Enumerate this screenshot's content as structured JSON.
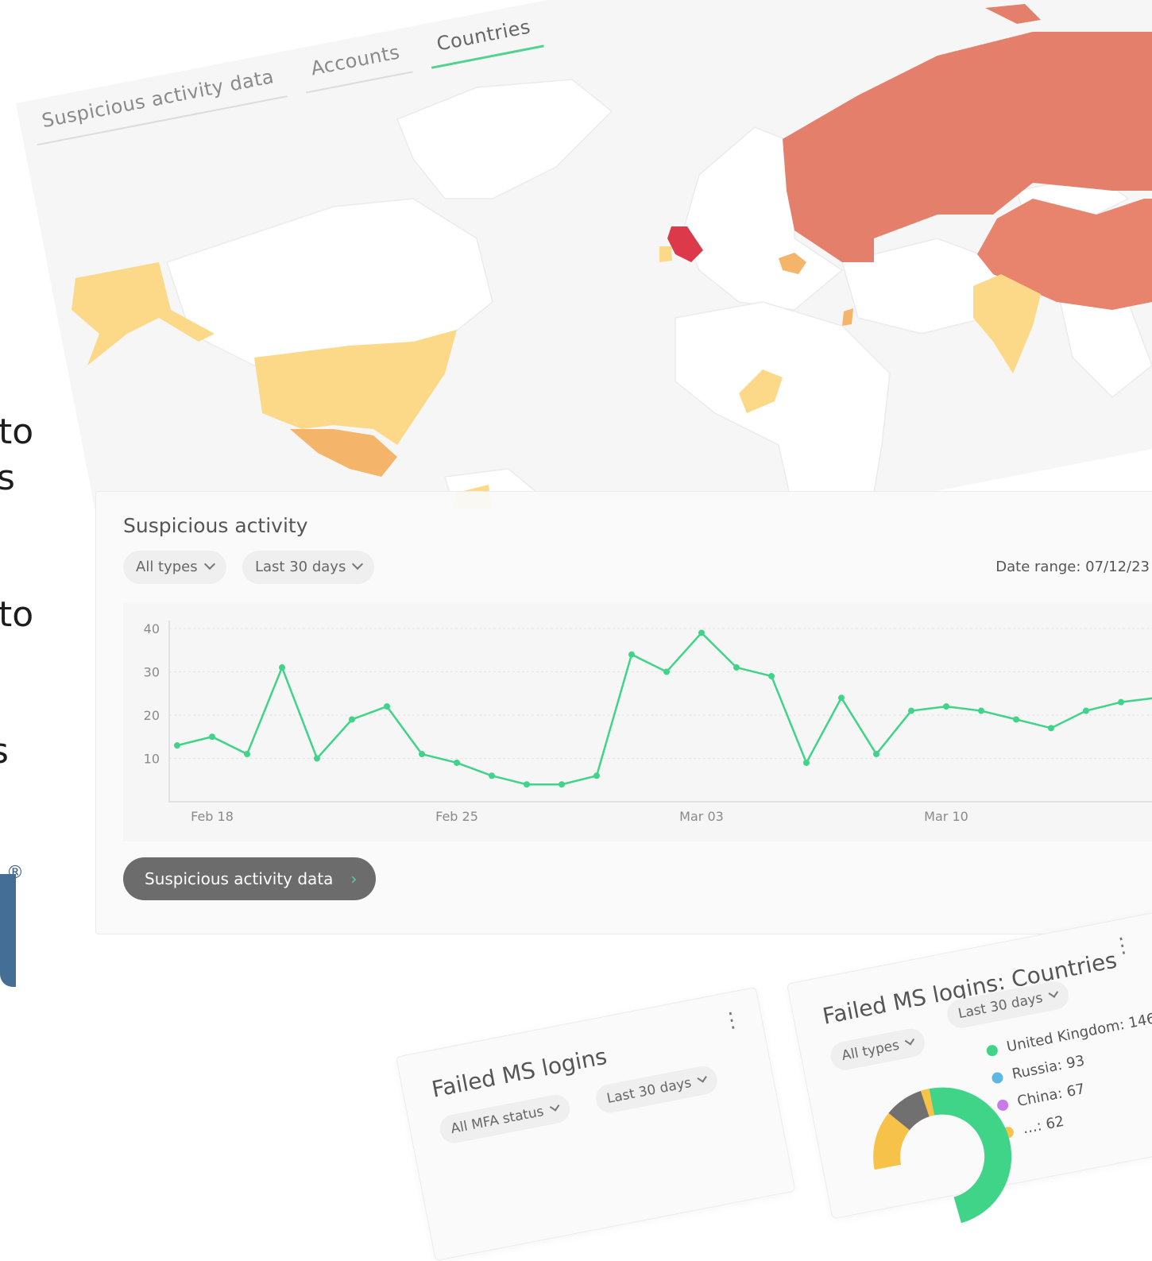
{
  "edge_texts": [
    "to",
    "s",
    "to",
    "s"
  ],
  "brand": {
    "registered": "®"
  },
  "tabs": [
    {
      "label": "Suspicious activity data",
      "active": false
    },
    {
      "label": "Accounts",
      "active": false
    },
    {
      "label": "Countries",
      "active": true
    }
  ],
  "map_colors": {
    "none": "#ffffff",
    "low": "#fbd988",
    "medium": "#f4b46a",
    "high": "#e47f6c",
    "highest": "#dc3a4b"
  },
  "card": {
    "title": "Suspicious activity",
    "filter_type": "All types",
    "filter_range": "Last 30 days",
    "date_range": "Date range: 07/12/23",
    "cta": "Suspicious activity data",
    "cta_arrow": "›"
  },
  "chart_data": {
    "type": "line",
    "x": [
      "Feb 17",
      "Feb 18",
      "Feb 19",
      "Feb 20",
      "Feb 21",
      "Feb 22",
      "Feb 23",
      "Feb 24",
      "Feb 25",
      "Feb 26",
      "Feb 27",
      "Feb 28",
      "Feb 29",
      "Mar 01",
      "Mar 02",
      "Mar 03",
      "Mar 04",
      "Mar 05",
      "Mar 06",
      "Mar 07",
      "Mar 08",
      "Mar 09",
      "Mar 10",
      "Mar 11",
      "Mar 12",
      "Mar 13",
      "Mar 14",
      "Mar 15",
      "Mar 16"
    ],
    "values": [
      13,
      15,
      11,
      31,
      10,
      19,
      22,
      11,
      9,
      6,
      4,
      4,
      6,
      34,
      30,
      39,
      31,
      29,
      9,
      24,
      11,
      21,
      22,
      21,
      19,
      17,
      21,
      23,
      24
    ],
    "xticks": [
      "Feb 18",
      "Feb 25",
      "Mar 03",
      "Mar 10"
    ],
    "yticks": [
      10,
      20,
      30,
      40
    ],
    "ylim": [
      0,
      40
    ],
    "color": "#3fd488",
    "grid": true
  },
  "failed_logins": {
    "title": "Failed MS logins",
    "filter_status": "All MFA status",
    "filter_range": "Last 30 days",
    "menu": "⋮"
  },
  "failed_countries": {
    "title": "Failed MS logins: Countries",
    "filter_type": "All types",
    "filter_range": "Last 30 days",
    "menu": "⋮",
    "legend": [
      {
        "label": "United Kingdom: 146",
        "color": "#3fd488"
      },
      {
        "label": "Russia: 93",
        "color": "#5ab8e3"
      },
      {
        "label": "China: 67",
        "color": "#c77be6"
      },
      {
        "label": "…: 62",
        "color": "#f7c24a"
      }
    ],
    "donut_colors": [
      "#3fd488",
      "#f7c24a",
      "#707070"
    ]
  }
}
